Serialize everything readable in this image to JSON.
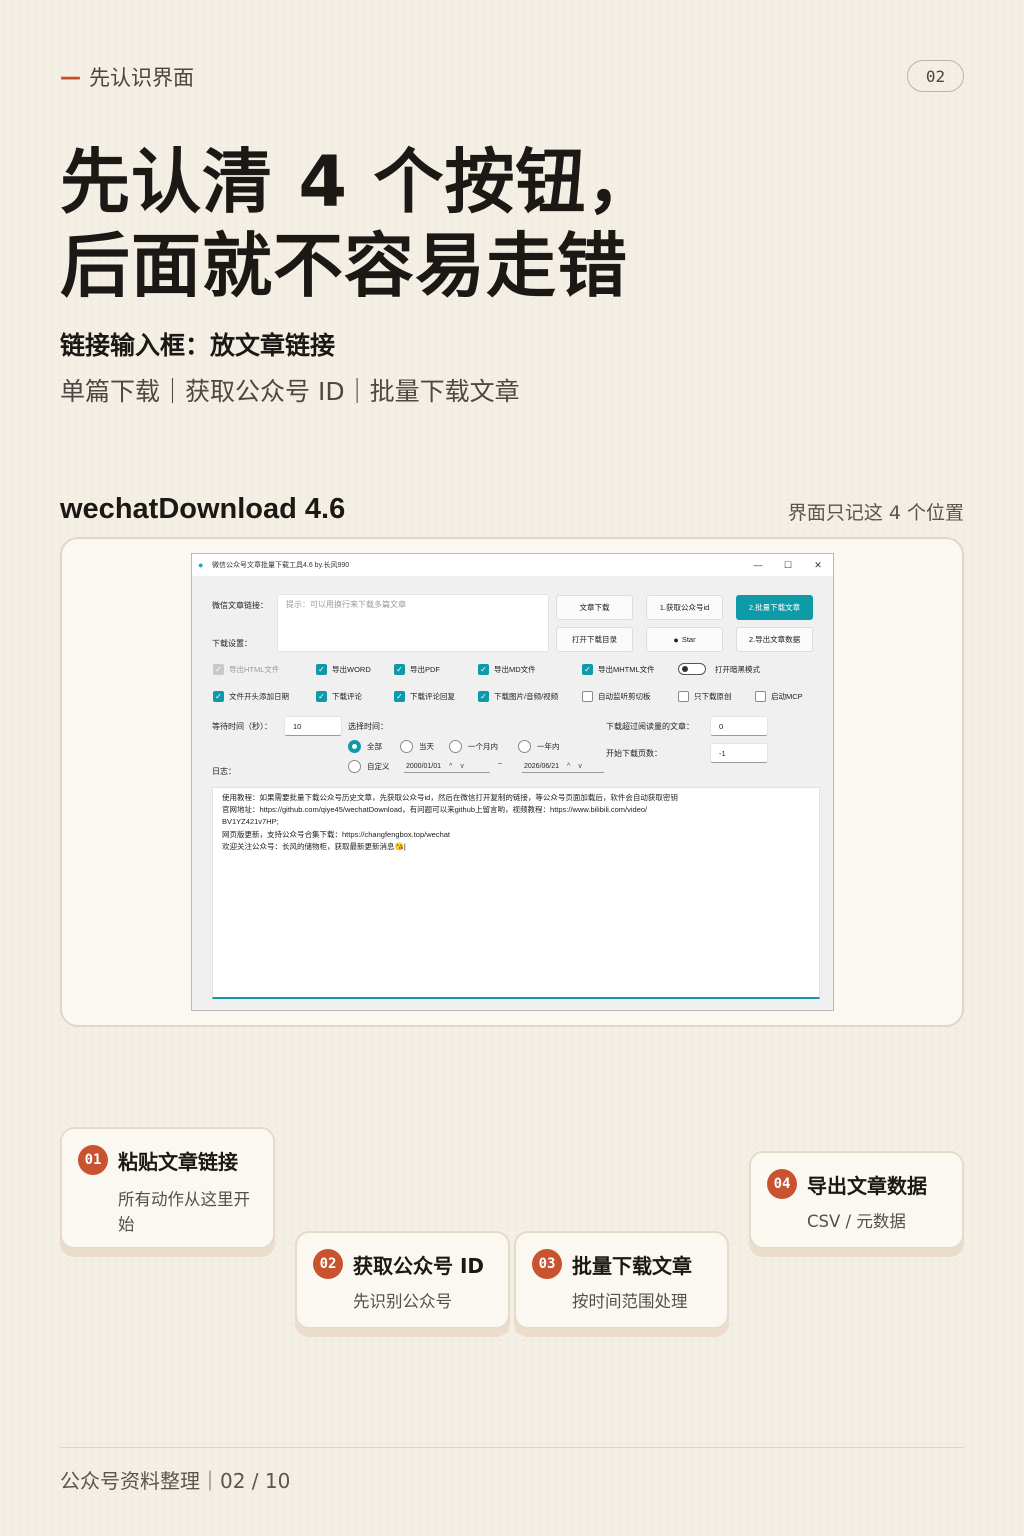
{
  "header": {
    "kicker_dash": "—",
    "kicker": "先认识界面",
    "page_pill": "02"
  },
  "headline": {
    "line1": "先认清 4 个按钮，",
    "line2": "后面就不容易走错"
  },
  "subhead": "链接输入框：放文章链接",
  "subline": "单篇下载｜获取公众号 ID｜批量下载文章",
  "app_label": "wechatDownload 4.6",
  "app_note": "界面只记这 4 个位置",
  "window": {
    "title": "微信公众号文章批量下载工具4.6 by.长风990",
    "minimize": "—",
    "maximize": "☐",
    "close": "✕",
    "url_label": "微信文章链接：",
    "url_placeholder": "提示：可以用换行来下载多篇文章",
    "settings_label": "下载设置：",
    "buttons": {
      "article_download": "文章下载",
      "get_id": "1.获取公众号id",
      "batch_download": "2.批量下载文章",
      "open_dir": "打开下载目录",
      "star": "Star",
      "export_data": "2.导出文章数据"
    },
    "options": [
      {
        "label": "导出HTML文件",
        "checked": true,
        "disabled": true
      },
      {
        "label": "导出WORD",
        "checked": true
      },
      {
        "label": "导出PDF",
        "checked": true
      },
      {
        "label": "导出MD文件",
        "checked": true
      },
      {
        "label": "导出MHTML文件",
        "checked": true
      },
      {
        "label": "打开暗黑模式",
        "toggle": true
      },
      {
        "label": "文件开头添加日期",
        "checked": true
      },
      {
        "label": "下载评论",
        "checked": true
      },
      {
        "label": "下载评论回复",
        "checked": true
      },
      {
        "label": "下载图片/音频/视频",
        "checked": true
      },
      {
        "label": "自动监听剪切板",
        "checked": false
      },
      {
        "label": "只下载原创",
        "checked": false
      },
      {
        "label": "启动MCP",
        "checked": false
      }
    ],
    "wait_label": "等待时间（秒）：",
    "wait_value": "10",
    "time_label": "选择时间：",
    "time_options": [
      "全部",
      "当天",
      "一个月内",
      "一年内",
      "自定义"
    ],
    "time_selected": "全部",
    "date_from": "2000/01/01",
    "date_to": "2026/06/21",
    "date_sep": "~",
    "views_label": "下载超过阅读量的文章：",
    "views_value": "0",
    "start_page_label": "开始下载页数：",
    "start_page_value": "-1",
    "log_label": "日志：",
    "log_lines": [
      "使用教程：如果需要批量下载公众号历史文章，先获取公众号id，然后在微信打开复制的链接，等公众号页面加载后，软件会自动获取密钥",
      "官网地址：https://github.com/qiye45/wechatDownload，有问题可以来github上留言哟，视频教程：https://www.bilibili.com/video/",
      "BV1YZ421v7HP;",
      "网页版更新，支持公众号合集下载：https://changfengbox.top/wechat",
      "欢迎关注公众号：长风的储物柜，获取最新更新消息😘|"
    ]
  },
  "callouts": [
    {
      "num": "01",
      "title": "粘贴文章链接",
      "desc": "所有动作从这里开始"
    },
    {
      "num": "02",
      "title": "获取公众号 ID",
      "desc": "先识别公众号"
    },
    {
      "num": "03",
      "title": "批量下载文章",
      "desc": "按时间范围处理"
    },
    {
      "num": "04",
      "title": "导出文章数据",
      "desc": "CSV / 元数据"
    }
  ],
  "footer": "公众号资料整理｜02 / 10",
  "colors": {
    "accent": "#c8532e",
    "teal": "#0e9aa7",
    "background": "#f4efe4"
  }
}
